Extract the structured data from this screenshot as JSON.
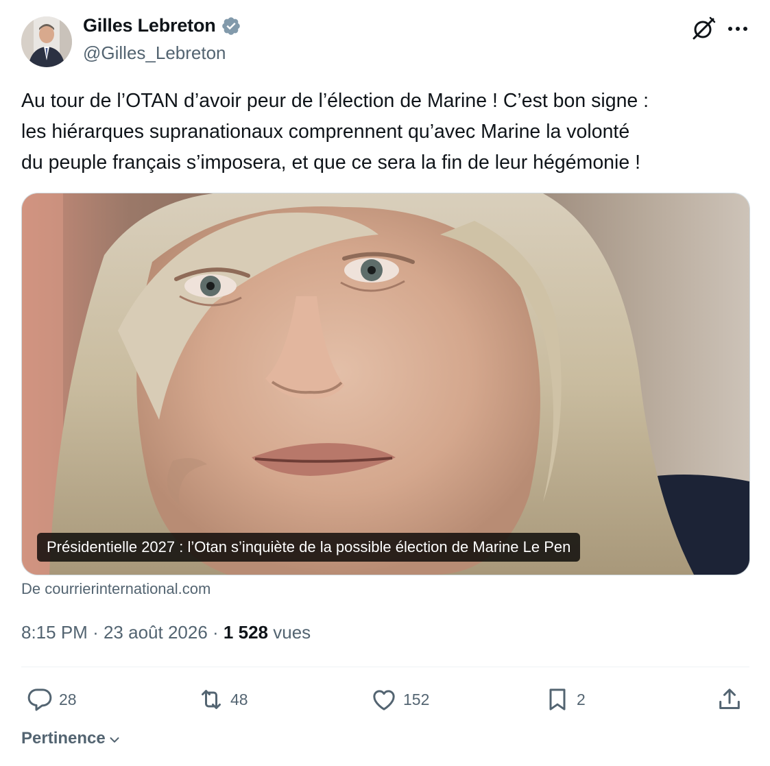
{
  "author": {
    "display_name": "Gilles Lebreton",
    "handle": "@Gilles_Lebreton",
    "verified_color": "#829aab"
  },
  "tweet": {
    "text": "Au tour de l’OTAN d’avoir peur de l’élection de Marine ! C’est bon signe :\nles hiérarques supranationaux comprennent qu’avec Marine la volonté\ndu peuple français s’imposera, et que ce sera la fin de leur hégémonie !"
  },
  "card": {
    "caption": "Présidentielle 2027 : l’Otan s’inquiète de la possible élection de Marine Le Pen",
    "source": "De courrierinternational.com"
  },
  "meta": {
    "time": "8:15 PM",
    "separator": "·",
    "date": "23 août 2026",
    "views_count": "1 528",
    "views_label": "vues"
  },
  "actions": {
    "replies": "28",
    "reposts": "48",
    "likes": "152",
    "bookmarks": "2"
  },
  "sort": {
    "label": "Pertinence"
  },
  "icons": {
    "header": [
      "grok-icon",
      "more-icon"
    ],
    "actions": [
      "reply-icon",
      "repost-icon",
      "like-icon",
      "bookmark-icon",
      "share-icon"
    ]
  },
  "colors": {
    "text": "#0f1419",
    "secondary": "#536471",
    "divider": "#eff3f4"
  }
}
